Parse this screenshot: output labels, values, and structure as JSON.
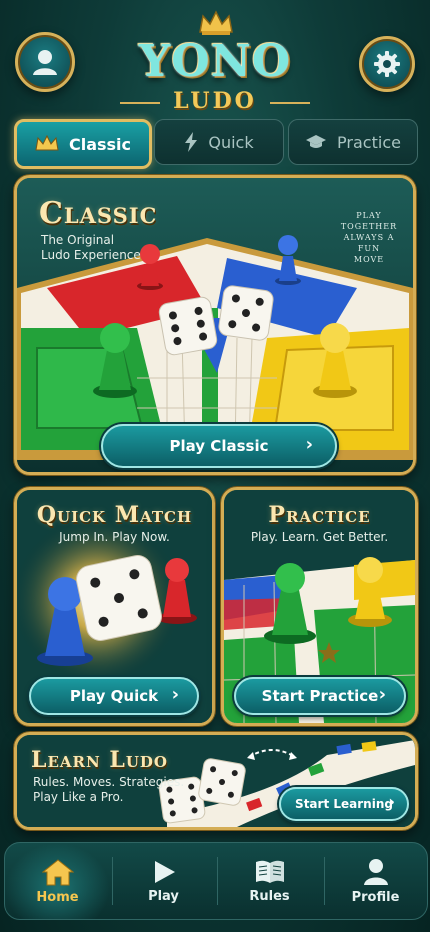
{
  "header": {
    "brand_top": "YONO",
    "brand_bottom": "LUDO",
    "profile_icon": "user-icon",
    "settings_icon": "gear-icon"
  },
  "tabs": [
    {
      "label": "Classic",
      "icon": "crown-icon",
      "active": true
    },
    {
      "label": "Quick",
      "icon": "lightning-icon",
      "active": false
    },
    {
      "label": "Practice",
      "icon": "graduation-cap-icon",
      "active": false
    }
  ],
  "classic": {
    "title": "Classic",
    "subtitle_line1": "The Original",
    "subtitle_line2": "Ludo Experience",
    "tagline_1": "PLAY",
    "tagline_2": "TOGETHER",
    "tagline_3": "ALWAYS A FUN",
    "tagline_4": "MOVE",
    "button": "Play Classic"
  },
  "quick": {
    "title": "Quick Match",
    "subtitle": "Jump In. Play Now.",
    "button": "Play Quick"
  },
  "practice": {
    "title": "Practice",
    "subtitle": "Play. Learn. Get Better.",
    "button": "Start Practice"
  },
  "learn": {
    "title": "Learn Ludo",
    "subtitle_line1": "Rules. Moves. Strategies.",
    "subtitle_line2": "Play Like a Pro.",
    "button": "Start Learning"
  },
  "nav": [
    {
      "label": "Home",
      "icon": "home-icon",
      "active": true
    },
    {
      "label": "Play",
      "icon": "play-icon",
      "active": false
    },
    {
      "label": "Rules",
      "icon": "book-icon",
      "active": false
    },
    {
      "label": "Profile",
      "icon": "person-icon",
      "active": false
    }
  ],
  "colors": {
    "gold": "#d7b25a",
    "teal": "#1a9aa0",
    "red": "#d8262b",
    "blue": "#2a5fd0",
    "green": "#23a23a",
    "yellow": "#f1c816"
  }
}
